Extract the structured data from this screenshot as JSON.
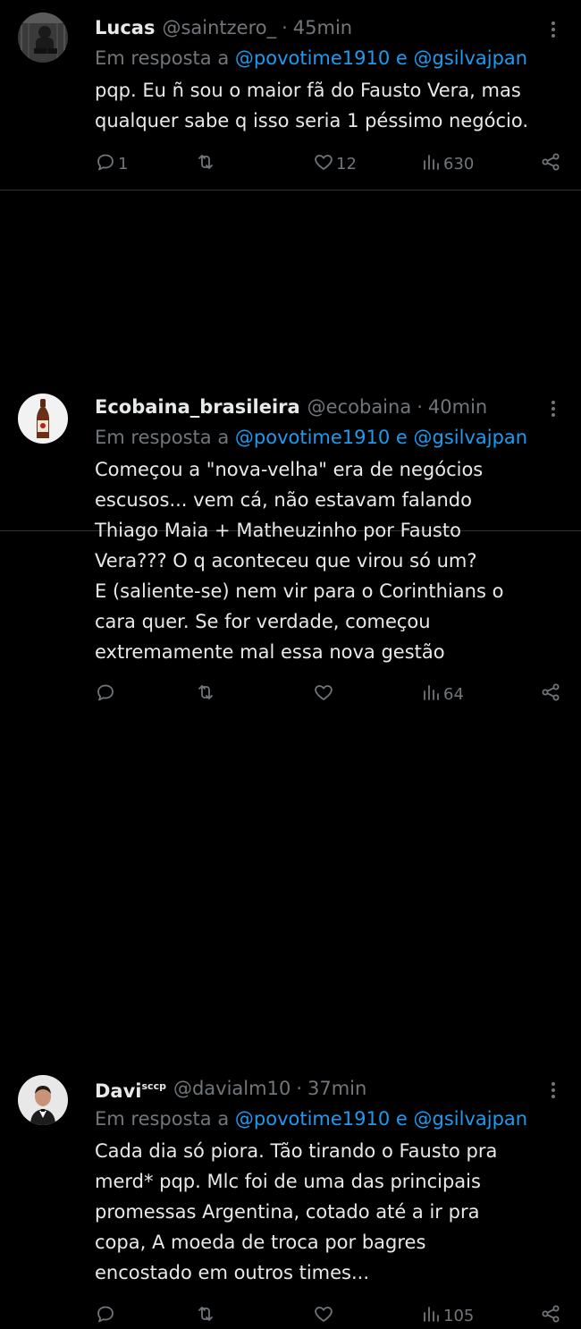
{
  "tweets": [
    {
      "name": "Lucas",
      "handle": "@saintzero_",
      "time": "45min",
      "reply_prefix": "Em resposta a",
      "mention1": "@povotime1910",
      "conj": "e",
      "mention2": "@gsilvajpan",
      "text": "pqp. Eu ñ sou o maior fã do Fausto Vera, mas\nqualquer sabe q isso seria 1 péssimo negócio.",
      "replies": "1",
      "retweets": "",
      "likes": "12",
      "views": "630"
    },
    {
      "name": "Ecobaina_brasileira",
      "handle": "@ecobaina",
      "time": "40min",
      "reply_prefix": "Em resposta a",
      "mention1": "@povotime1910",
      "conj": "e",
      "mention2": "@gsilvajpan",
      "text": "Começou a \"nova-velha\" era de negócios\nescusos... vem cá, não estavam falando\nThiago Maia + Matheuzinho por Fausto\nVera??? O q aconteceu que virou só um?\nE (saliente-se) nem vir para o Corinthians o\ncara quer. Se for verdade, começou\nextremamente mal essa nova gestão",
      "replies": "",
      "retweets": "",
      "likes": "",
      "views": "64"
    },
    {
      "name": "Davi",
      "name_sup": "sccp",
      "handle": "@davialm10",
      "time": "37min",
      "reply_prefix": "Em resposta a",
      "mention1": "@povotime1910",
      "conj": "e",
      "mention2": "@gsilvajpan",
      "text": "Cada dia só piora. Tão tirando o Fausto pra\nmerd* pqp. Mlc  foi de uma das principais\npromessas Argentina, cotado até a ir pra\ncopa, A moeda de troca por bagres\nencostado em outros times...",
      "replies": "",
      "retweets": "",
      "likes": "",
      "views": "105"
    }
  ],
  "separator": "·",
  "colors": {
    "background": "#000000",
    "text": "#e7e9ea",
    "muted": "#71767b",
    "link": "#1d9bf0",
    "divider": "#2f3336"
  },
  "icons": [
    "reply-icon",
    "retweet-icon",
    "like-icon",
    "views-icon",
    "share-icon",
    "more-icon"
  ]
}
